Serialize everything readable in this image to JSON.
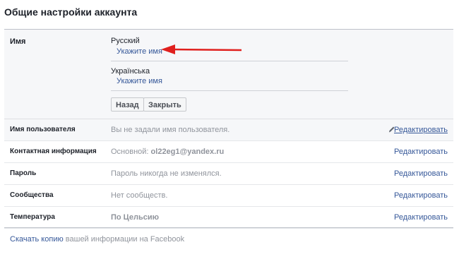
{
  "page": {
    "title": "Общие настройки аккаунта"
  },
  "name_section": {
    "label": "Имя",
    "russian": {
      "title": "Русский",
      "link": "Укажите имя"
    },
    "ukrainian": {
      "title": "Українська",
      "link": "Укажите имя"
    },
    "back_button": "Назад",
    "close_button": "Закрыть"
  },
  "rows": [
    {
      "label": "Имя пользователя",
      "value": "Вы не задали имя пользователя.",
      "action": "Редактировать"
    },
    {
      "label": "Контактная информация",
      "value_prefix": "Основной: ",
      "value_strong": "ol22eg1@yandex.ru",
      "action": "Редактировать"
    },
    {
      "label": "Пароль",
      "value": "Пароль никогда не изменялся.",
      "action": "Редактировать"
    },
    {
      "label": "Сообщества",
      "value": "Нет сообществ.",
      "action": "Редактировать"
    },
    {
      "label": "Температура",
      "value": "По Цельсию",
      "action": "Редактировать"
    }
  ],
  "footer": {
    "download_link": "Скачать копию",
    "download_text": " вашей информации на Facebook"
  },
  "icons": {
    "pencil": "pencil-icon",
    "arrow": "red-arrow-annotation"
  },
  "colors": {
    "link": "#365899",
    "annotation": "#e0201e",
    "muted_text": "#90949c",
    "section_bg": "#f6f7f9"
  }
}
